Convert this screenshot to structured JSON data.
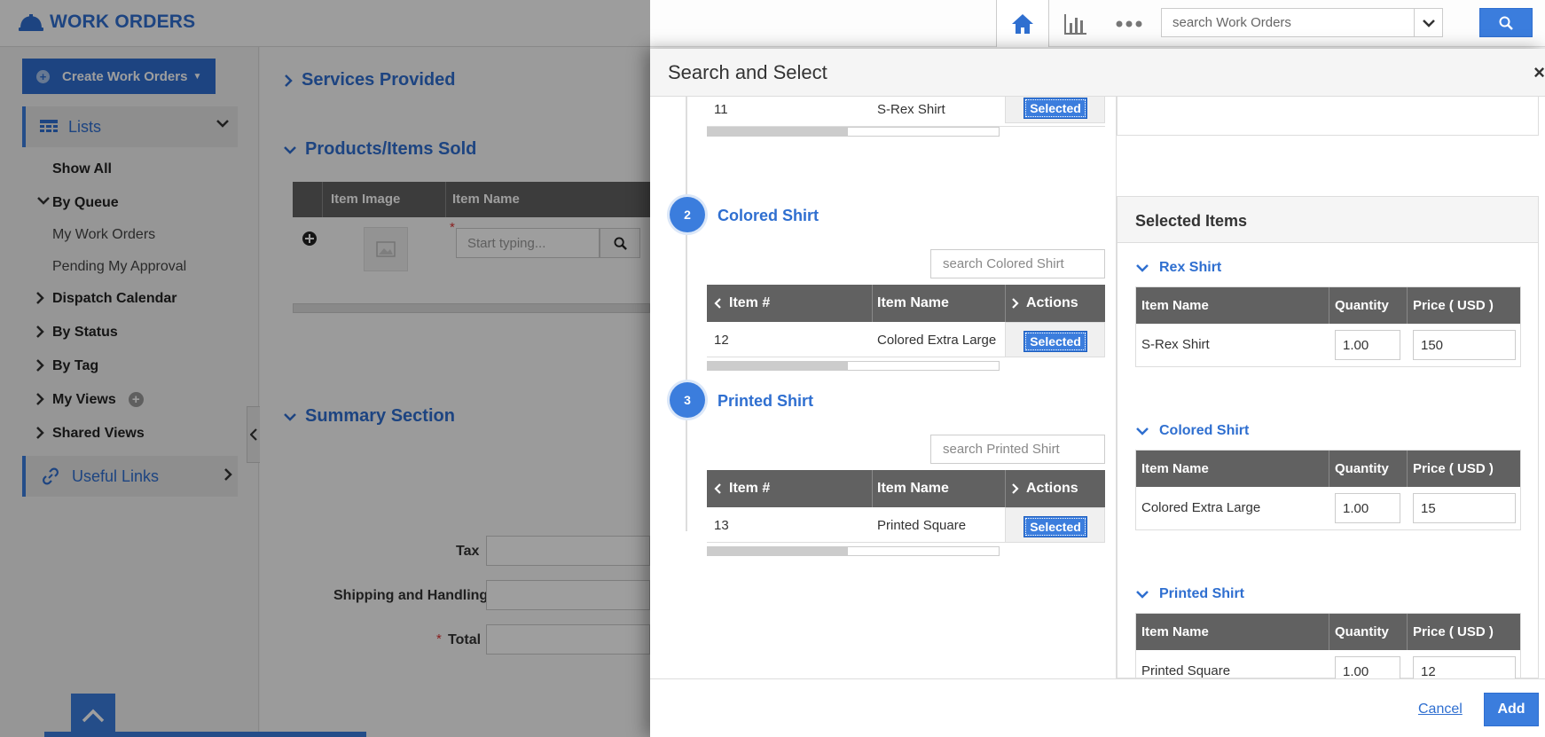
{
  "app": {
    "title": "WORK ORDERS"
  },
  "topbar": {
    "search_placeholder": "search Work Orders"
  },
  "sidebar": {
    "create_label": "Create Work Orders",
    "lists_label": "Lists",
    "items": {
      "show_all": "Show All",
      "by_queue": "By Queue",
      "my_work_orders": "My Work Orders",
      "pending_approval": "Pending My Approval",
      "dispatch_calendar": "Dispatch Calendar",
      "by_status": "By Status",
      "by_tag": "By Tag",
      "my_views": "My Views",
      "shared_views": "Shared Views"
    },
    "useful_links": "Useful Links"
  },
  "main": {
    "services_title": "Services Provided",
    "products_title": "Products/Items Sold",
    "col_item_image": "Item Image",
    "col_item_name": "Item Name",
    "item_name_placeholder": "Start typing...",
    "summary_title": "Summary Section",
    "tax_label": "Tax",
    "shipping_label": "Shipping and Handling",
    "total_label": "Total"
  },
  "modal": {
    "title": "Search and Select",
    "close": "×",
    "prev_row": {
      "item_no": "11",
      "item_name": "S-Rex Shirt",
      "action": "Selected"
    },
    "groups": [
      {
        "step": "2",
        "title": "Colored Shirt",
        "search_placeholder": "search Colored Shirt",
        "col_item_no": "Item #",
        "col_item_name": "Item Name",
        "col_actions": "Actions",
        "row": {
          "item_no": "12",
          "item_name": "Colored Extra Large",
          "action": "Selected"
        }
      },
      {
        "step": "3",
        "title": "Printed Shirt",
        "search_placeholder": "search Printed Shirt",
        "col_item_no": "Item #",
        "col_item_name": "Item Name",
        "col_actions": "Actions",
        "row": {
          "item_no": "13",
          "item_name": "Printed Square",
          "action": "Selected"
        }
      }
    ],
    "selected_items": {
      "title": "Selected Items",
      "col_item_name": "Item Name",
      "col_quantity": "Quantity",
      "col_price": "Price ( USD )",
      "groups": [
        {
          "title": "Rex Shirt",
          "item_name": "S-Rex Shirt",
          "quantity": "1.00",
          "price": "150"
        },
        {
          "title": "Colored Shirt",
          "item_name": "Colored Extra Large",
          "quantity": "1.00",
          "price": "15"
        },
        {
          "title": "Printed Shirt",
          "item_name": "Printed Square",
          "quantity": "1.00",
          "price": "12"
        }
      ]
    },
    "cancel_label": "Cancel",
    "add_label": "Add"
  },
  "colors": {
    "accent": "#3b7ddd",
    "header_dark": "#616161",
    "link": "#2f6fd0"
  }
}
